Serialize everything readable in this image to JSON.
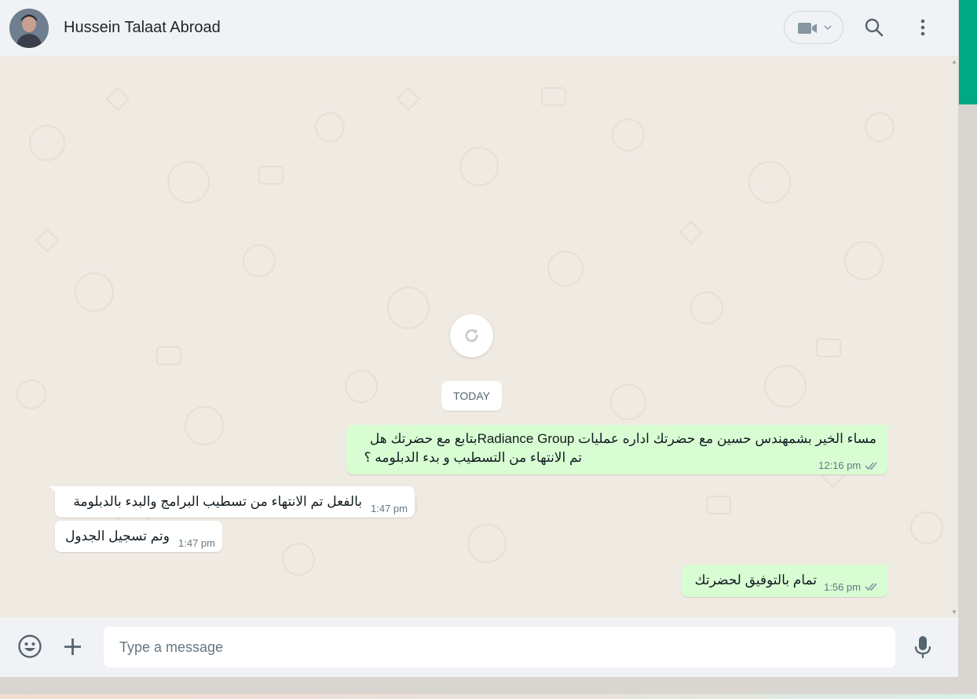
{
  "header": {
    "contact_name": "Hussein Talaat Abroad",
    "icons": [
      "avatar",
      "video-call-icon",
      "chevron-down-icon",
      "search-icon",
      "menu-icon"
    ]
  },
  "chat": {
    "date_divider": "TODAY",
    "refresh_icon": "refresh-icon",
    "messages": [
      {
        "direction": "outgoing",
        "lines": [
          "مساء الخير بشمهندس حسين مع  حضرتك اداره عمليات Radiance Groupبتابع مع حضرتك هل",
          "تم الانتهاء من التسطيب و بدء الدبلومه ؟"
        ],
        "time": "12:16 pm",
        "status": "read-double-check"
      },
      {
        "direction": "incoming",
        "lines": [
          "بالفعل تم الانتهاء من تسطيب البرامج والبدء بالدبلومة"
        ],
        "time": "1:47 pm"
      },
      {
        "direction": "incoming",
        "lines": [
          "وتم تسجيل الجدول"
        ],
        "time": "1:47 pm"
      },
      {
        "direction": "outgoing",
        "lines": [
          "تمام بالتوفيق لحضرتك"
        ],
        "time": "1:56 pm",
        "status": "read-double-check"
      }
    ]
  },
  "composer": {
    "placeholder": "Type a message",
    "icons": [
      "emoji-icon",
      "attach-plus-icon",
      "microphone-icon"
    ]
  },
  "colors": {
    "header_bg": "#f0f2f5",
    "chat_bg": "#efeae2",
    "outgoing_bubble": "#d9fdd3",
    "incoming_bubble": "#ffffff",
    "accent": "#00a884"
  }
}
